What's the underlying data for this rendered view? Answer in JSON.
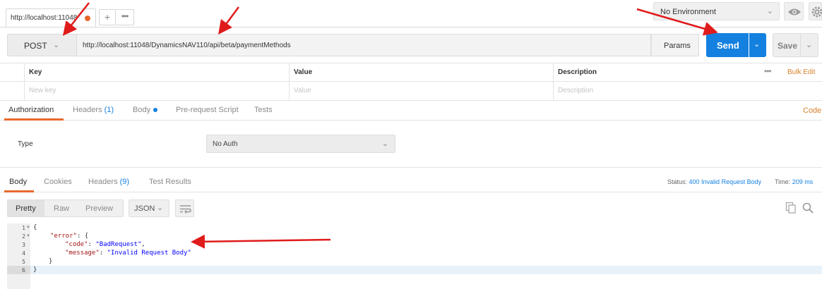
{
  "tabs": {
    "active_tab_title": "http://localhost:11048",
    "add_tab_label": "+",
    "more_label": "•••"
  },
  "environment": {
    "selected": "No Environment"
  },
  "request": {
    "method": "POST",
    "url": "http://localhost:11048/DynamicsNAV110/api/beta/paymentMethods",
    "params_label": "Params",
    "send_label": "Send",
    "save_label": "Save"
  },
  "params_table": {
    "headers": [
      "Key",
      "Value",
      "Description"
    ],
    "placeholders": [
      "New key",
      "Value",
      "Description"
    ],
    "more_label": "•••",
    "bulk_edit_label": "Bulk Edit"
  },
  "request_tabs": {
    "authorization": "Authorization",
    "headers": "Headers",
    "headers_count": "(1)",
    "body": "Body",
    "pre_request": "Pre-request Script",
    "tests": "Tests",
    "code_link": "Code"
  },
  "auth": {
    "type_label": "Type",
    "type_value": "No Auth"
  },
  "response_tabs": {
    "body": "Body",
    "cookies": "Cookies",
    "headers": "Headers",
    "headers_count": "(9)",
    "test_results": "Test Results",
    "status_label": "Status:",
    "status_value": "400 Invalid Request Body",
    "time_label": "Time:",
    "time_value": "209 ms"
  },
  "response_toolbar": {
    "pretty": "Pretty",
    "raw": "Raw",
    "preview": "Preview",
    "format": "JSON"
  },
  "response_body": {
    "line_numbers": [
      "1",
      "2",
      "3",
      "4",
      "5",
      "6"
    ],
    "open_brace": "{",
    "error_key": "\"error\"",
    "error_open": ": {",
    "code_key": "\"code\"",
    "code_value": "\"BadRequest\"",
    "message_key": "\"message\"",
    "message_value": "\"Invalid Request Body\"",
    "inner_close": "}",
    "outer_close": "}"
  },
  "colors": {
    "accent_orange": "#e8692c",
    "send_blue": "#1481e0",
    "annotation_red": "#e01b1b"
  }
}
